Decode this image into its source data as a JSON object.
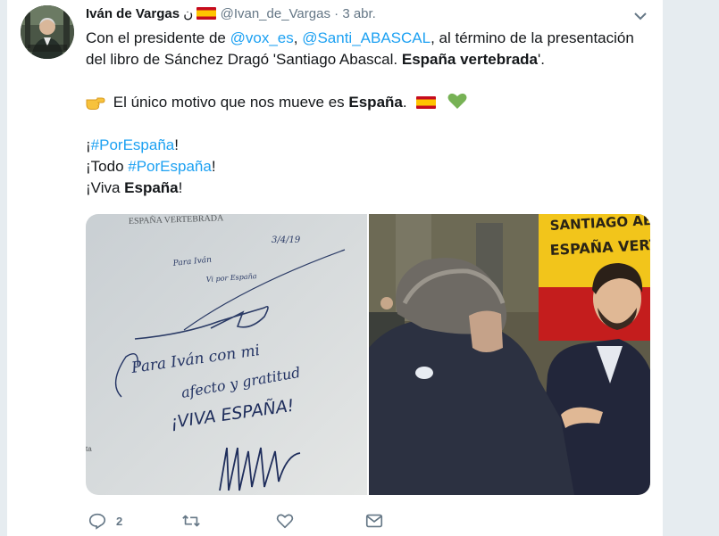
{
  "tweet": {
    "author_name": "Iván de Vargas",
    "author_suffix": "ن",
    "handle": "@Ivan_de_Vargas",
    "separator": "·",
    "date": "3 abr.",
    "line1": {
      "t1": "Con el presidente de ",
      "m1": "@vox_es",
      "t2": ", ",
      "m2": "@Santi_ABASCAL",
      "t3": ", al término de la presentación"
    },
    "line2": {
      "t1": "del libro de Sánchez Dragó 'Santiago Abascal. ",
      "b1": "España vertebrada",
      "t2": "'."
    },
    "line3": {
      "t1": "El único motivo que nos mueve es ",
      "b1": "España",
      "t2": "."
    },
    "line4": {
      "t1": "¡",
      "h1": "#PorEspaña",
      "t2": "!"
    },
    "line5": {
      "t1": "¡Todo ",
      "h1": "#PorEspaña",
      "t2": "!"
    },
    "line6": {
      "t1": "¡Viva ",
      "b1": "España",
      "t2": "!"
    },
    "photo_left": {
      "book_header": "ESPAÑA VERTEBRADA",
      "date": "3/4/19",
      "line_a": "Para Iván",
      "line_b": "Vi por España",
      "line_c": "Para Iván con mi",
      "line_d": "afecto y gratitud",
      "line_e": "¡VIVA ESPAÑA!",
      "margin_text": "ta"
    },
    "photo_right": {
      "banner_line1": "SANTIAGO AB",
      "banner_line2": "ESPAÑA VERTE"
    },
    "actions": {
      "reply_count": "2",
      "retweet_count": "",
      "like_count": ""
    },
    "colors": {
      "link": "#1da1f2",
      "muted": "#657786",
      "heart": "#77b255"
    }
  }
}
